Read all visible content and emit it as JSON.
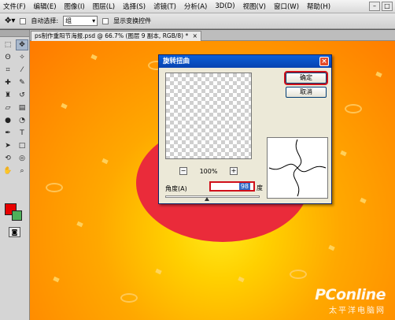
{
  "menu": [
    "文件(F)",
    "编辑(E)",
    "图像(I)",
    "图层(L)",
    "选择(S)",
    "滤镜(T)",
    "分析(A)",
    "3D(D)",
    "视图(V)",
    "窗口(W)",
    "帮助(H)"
  ],
  "options_bar": {
    "auto_select_label": "自动选择:",
    "auto_select_value": "组",
    "show_transform_label": "显示变换控件"
  },
  "document": {
    "tab_title": "ps制作重阳节海报.psd @ 66.7% (图层 9 副本, RGB/8) *",
    "tab_close": "×"
  },
  "dialog": {
    "title": "旋转扭曲",
    "ok_label": "确定",
    "cancel_label": "取消",
    "zoom_value": "100%",
    "zoom_minus": "−",
    "zoom_plus": "+",
    "angle_label": "角度(A)",
    "angle_value": "98",
    "angle_unit": "度",
    "close_glyph": "×"
  },
  "watermark": {
    "brand": "PConline",
    "tagline": "太平洋电脑网"
  },
  "colors": {
    "foreground": "#e80000",
    "background": "#4db05a",
    "highlight": "#d0101a"
  }
}
